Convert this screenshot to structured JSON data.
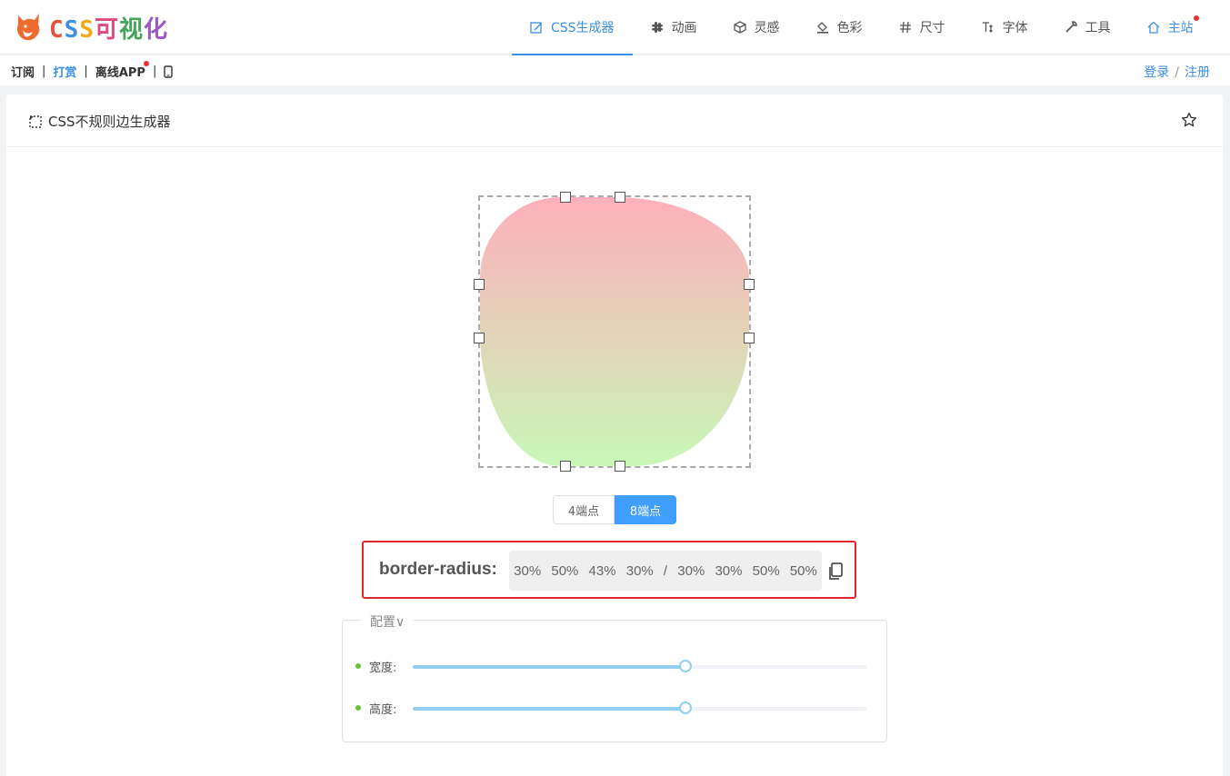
{
  "logo": {
    "text_parts": [
      "C",
      "S",
      "S",
      "可",
      "视",
      "化"
    ]
  },
  "nav": {
    "items": [
      {
        "label": "CSS生成器",
        "icon": "edit-icon",
        "active": true
      },
      {
        "label": "动画",
        "icon": "slack-icon"
      },
      {
        "label": "灵感",
        "icon": "cube-icon"
      },
      {
        "label": "色彩",
        "icon": "paint-bucket-icon"
      },
      {
        "label": "尺寸",
        "icon": "hash-icon"
      },
      {
        "label": "字体",
        "icon": "text-size-icon"
      },
      {
        "label": "工具",
        "icon": "wrench-icon"
      },
      {
        "label": "主站",
        "icon": "home-icon"
      }
    ]
  },
  "subbar": {
    "subscribe": "订阅",
    "sep": "|",
    "tip": "打赏",
    "offline_app": "离线APP",
    "login": "登录",
    "slash": "/",
    "register": "注册"
  },
  "card": {
    "title": "CSS不规则边生成器"
  },
  "toggle": {
    "four_points": "4端点",
    "eight_points": "8端点",
    "selected": "8端点"
  },
  "output": {
    "label": "border-radius:",
    "values": "30% 50% 43% 30% / 30% 30% 50% 50%"
  },
  "settings": {
    "legend": "配置∨",
    "width_label": "宽度:",
    "height_label": "高度:",
    "width_value": 0.6,
    "height_value": 0.6
  },
  "colors": {
    "accent": "#409eff",
    "highlight_border": "#e0262a",
    "gradient_top": "#fdb0bc",
    "gradient_bottom": "#c8f8b8"
  }
}
